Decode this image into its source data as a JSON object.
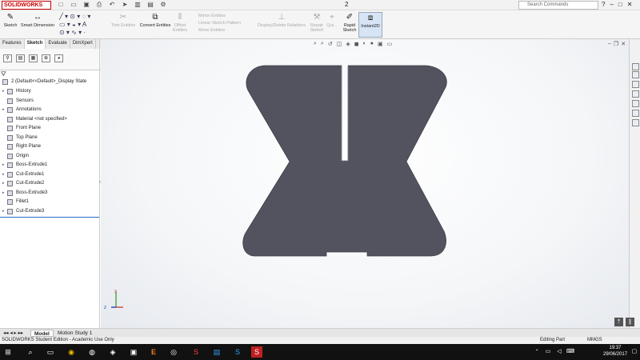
{
  "app": {
    "logo": "SOLIDWORKS",
    "doc_title": "2"
  },
  "search": {
    "placeholder": "Search Commands"
  },
  "ribbon": {
    "sketch": "Sketch",
    "smart_dimension": "Smart Dimension",
    "trim_entities": "Trim Entities",
    "convert_entities": "Convert Entities",
    "offset_entities": "Offset Entities",
    "mirror_entities": "Mirror Entities",
    "linear_pattern": "Linear Sketch Pattern",
    "move_entities": "Move Entities",
    "display_delete_relations": "Display/Delete Relations",
    "repair_sketch": "Repair Sketch",
    "quick_snaps": "Qui...",
    "rapid_sketch": "Rapid Sketch",
    "instant2d": "Instant2D"
  },
  "command_tabs": [
    "Features",
    "Sketch",
    "Evaluate",
    "DimXpert"
  ],
  "active_command_tab": "Sketch",
  "tree": {
    "root": "2  (Default<<Default>_Display State",
    "items": [
      "History",
      "Sensors",
      "Annotations",
      "Material <not specified>",
      "Front Plane",
      "Top Plane",
      "Right Plane",
      "Origin",
      "Boss-Extrude1",
      "Cut-Extrude1",
      "Cut-Extrude2",
      "Boss-Extrude3",
      "Fillet1",
      "Cut-Extrude3"
    ]
  },
  "bottom_tabs": [
    "Model",
    "Motion Study 1"
  ],
  "active_bottom_tab": "Model",
  "status": {
    "left": "SOLIDWORKS Student Edition - Academic Use Only",
    "mode": "Editing Part",
    "units": "MMGS"
  },
  "clock": {
    "time": "19:37",
    "date": "29/06/2017"
  },
  "triad": {
    "x": "X",
    "y": "Y",
    "z": "Z"
  },
  "colors": {
    "part": "#52535e",
    "accent": "#c00000",
    "selection": "#2a6cc8"
  }
}
